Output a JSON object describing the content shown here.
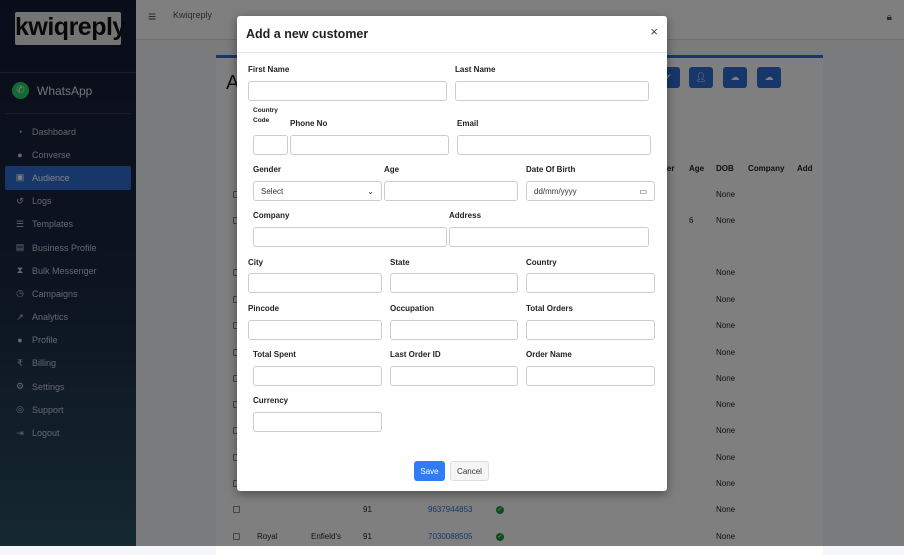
{
  "sidebar": {
    "logo": "kwiqreply",
    "channel": "WhatsApp",
    "items": [
      {
        "label": "Dashboard",
        "icon": "dashboard-icon",
        "glyph": "◔"
      },
      {
        "label": "Converse",
        "icon": "chat-icon",
        "glyph": "●"
      },
      {
        "label": "Audience",
        "icon": "contact-card-icon",
        "glyph": "▣",
        "active": true
      },
      {
        "label": "Logs",
        "icon": "history-icon",
        "glyph": "↺"
      },
      {
        "label": "Templates",
        "icon": "list-icon",
        "glyph": "☰"
      },
      {
        "label": "Business Profile",
        "icon": "id-card-icon",
        "glyph": "▤"
      },
      {
        "label": "Bulk Messenger",
        "icon": "hourglass-icon",
        "glyph": "⧗"
      },
      {
        "label": "Campaigns",
        "icon": "clock-icon",
        "glyph": "◷"
      },
      {
        "label": "Analytics",
        "icon": "line-chart-icon",
        "glyph": "↗"
      },
      {
        "label": "Profile",
        "icon": "user-icon",
        "glyph": "●"
      },
      {
        "label": "Billing",
        "icon": "rupee-icon",
        "glyph": "₹"
      },
      {
        "label": "Settings",
        "icon": "gears-icon",
        "glyph": "⚙"
      },
      {
        "label": "Support",
        "icon": "globe-icon",
        "glyph": "◎"
      },
      {
        "label": "Logout",
        "icon": "logout-icon",
        "glyph": "⇥"
      }
    ]
  },
  "topbar": {
    "brand": "Kwiqreply"
  },
  "page": {
    "title_partial": "A",
    "columns": [
      "der",
      "Age",
      "DOB",
      "Company",
      "Add"
    ],
    "rows": [
      {
        "age": "",
        "dob": "None"
      },
      {
        "age": "6",
        "dob": "None"
      },
      {
        "dob": "None"
      },
      {
        "dob": "None"
      },
      {
        "dob": "None"
      },
      {
        "dob": "None"
      },
      {
        "dob": "None"
      },
      {
        "dob": "None"
      },
      {
        "dob": "None"
      },
      {
        "dob": "None"
      },
      {
        "dob": "None"
      },
      {
        "first": "",
        "last": "",
        "code": "91",
        "phone": "9637944853",
        "dob": "None"
      },
      {
        "first": "Royal",
        "last": "Enfield's",
        "code": "91",
        "phone": "7030088505",
        "dob": "None"
      }
    ]
  },
  "modal": {
    "title": "Add a new customer",
    "close": "×",
    "fields": {
      "first_name": {
        "label": "First Name",
        "value": ""
      },
      "last_name": {
        "label": "Last Name",
        "value": ""
      },
      "country_code": {
        "label": "Country Code",
        "value": ""
      },
      "phone": {
        "label": "Phone No",
        "value": ""
      },
      "email": {
        "label": "Email",
        "value": ""
      },
      "gender": {
        "label": "Gender",
        "value": "Select"
      },
      "age": {
        "label": "Age",
        "value": ""
      },
      "dob": {
        "label": "Date Of Birth",
        "value": "dd/mm/yyyy"
      },
      "company": {
        "label": "Company",
        "value": ""
      },
      "address": {
        "label": "Address",
        "value": ""
      },
      "city": {
        "label": "City",
        "value": ""
      },
      "state": {
        "label": "State",
        "value": ""
      },
      "country": {
        "label": "Country",
        "value": ""
      },
      "pincode": {
        "label": "Pincode",
        "value": ""
      },
      "occupation": {
        "label": "Occupation",
        "value": ""
      },
      "total_orders": {
        "label": "Total Orders",
        "value": ""
      },
      "total_spent": {
        "label": "Total Spent",
        "value": ""
      },
      "last_order_id": {
        "label": "Last Order ID",
        "value": ""
      },
      "order_name": {
        "label": "Order Name",
        "value": ""
      },
      "currency": {
        "label": "Currency",
        "value": ""
      }
    },
    "save": "Save",
    "cancel": "Cancel"
  }
}
